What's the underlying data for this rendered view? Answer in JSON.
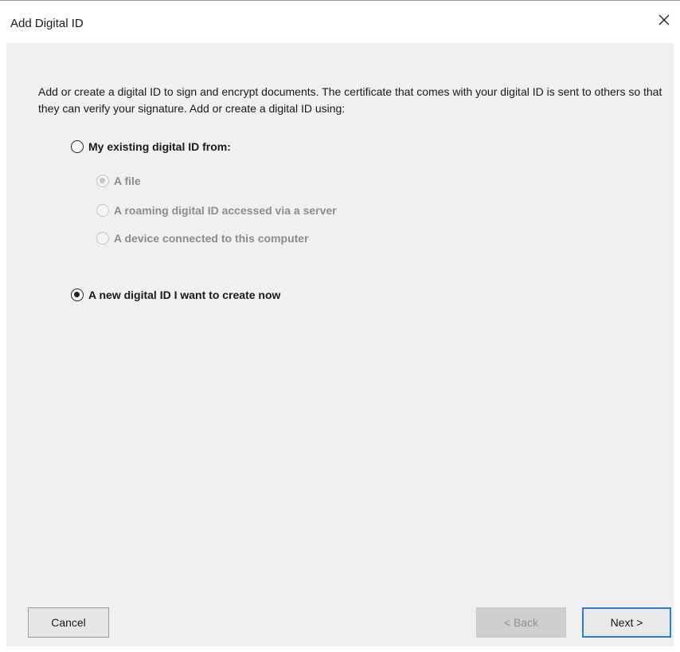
{
  "window": {
    "title": "Add Digital ID",
    "close_icon": "close-icon"
  },
  "intro_text": "Add or create a digital ID to sign and encrypt documents. The certificate that comes with your digital ID is sent to others so that they can verify your signature. Add or create a digital ID using:",
  "options": {
    "existing": {
      "label": "My existing digital ID from:",
      "selected": false
    },
    "sub_options": [
      {
        "label": "A file",
        "selected": true,
        "enabled": false
      },
      {
        "label": "A roaming digital ID accessed via a server",
        "selected": false,
        "enabled": false
      },
      {
        "label": "A device connected to this computer",
        "selected": false,
        "enabled": false
      }
    ],
    "create_new": {
      "label": "A new digital ID I want to create now",
      "selected": true
    }
  },
  "buttons": {
    "cancel": "Cancel",
    "back": "< Back",
    "back_enabled": false,
    "next": "Next >"
  },
  "colors": {
    "panel_bg": "#f0f0f0",
    "focus_border": "#2b7cd3",
    "disabled_text": "#8c8c8c"
  }
}
